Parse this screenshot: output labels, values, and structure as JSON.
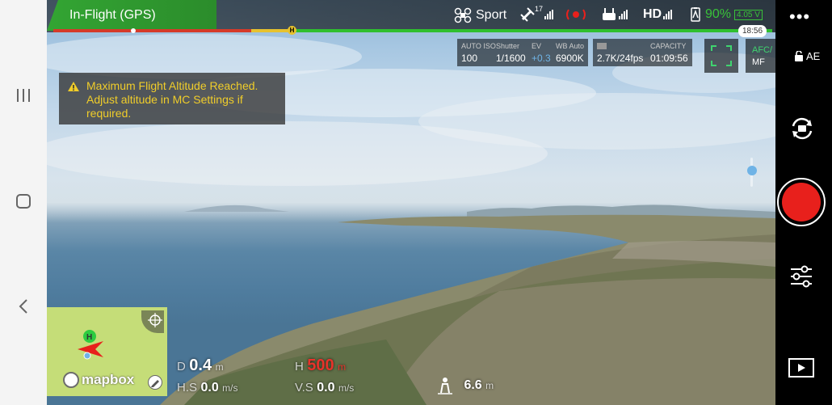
{
  "status": {
    "mode": "In-Flight (GPS)",
    "flight_mode": "Sport",
    "gps_count": "17",
    "video": "HD",
    "battery_pct": "90%",
    "battery_voltage": "4.05 V",
    "flight_time": "18:56"
  },
  "camera": {
    "iso_label": "AUTO ISO",
    "iso_value": "100",
    "shutter_label": "Shutter",
    "shutter_value": "1/1600",
    "ev_label": "EV",
    "ev_value": "+0.3",
    "wb_label": "WB Auto",
    "wb_value": "6900K",
    "res_value": "2.7K/24fps",
    "capacity_label": "CAPACITY",
    "capacity_value": "01:09:56",
    "af_top": "AFC/",
    "af_bottom": "MF"
  },
  "warning": {
    "text": "Maximum Flight Altitude Reached. Adjust altitude in MC Settings if required."
  },
  "right": {
    "ae_label": "AE",
    "more": "•••"
  },
  "map": {
    "brand": "mapbox",
    "home": "H"
  },
  "telemetry": {
    "d_label": "D",
    "d_value": "0.4",
    "d_unit": "m",
    "h_label": "H",
    "h_value": "500",
    "h_unit": "m",
    "hs_label": "H.S",
    "hs_value": "0.0",
    "hs_unit": "m/s",
    "vs_label": "V.S",
    "vs_value": "0.0",
    "vs_unit": "m/s",
    "vps_value": "6.6",
    "vps_unit": "m"
  },
  "colors": {
    "accent_green": "#33a533",
    "warning_yellow": "#f0cd2a",
    "record_red": "#e8201c",
    "altitude_red": "#e8322a"
  },
  "icons": [
    "recent-apps-icon",
    "home-icon",
    "back-icon",
    "drone-icon",
    "gps-icon",
    "obstacle-sensor-icon",
    "remote-controller-icon",
    "battery-icon",
    "warning-icon",
    "lock-icon",
    "camera-switch-icon",
    "settings-sliders-icon",
    "playback-icon",
    "locate-icon",
    "edit-icon",
    "person-icon"
  ]
}
